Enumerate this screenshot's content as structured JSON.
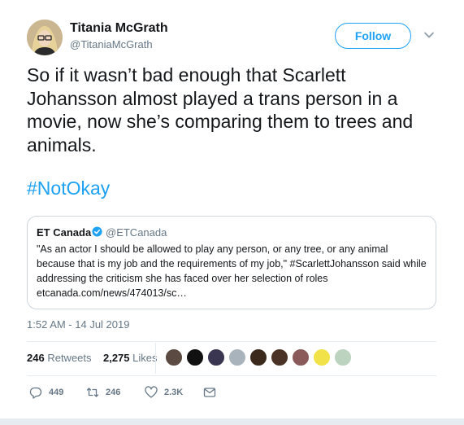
{
  "author": {
    "name": "Titania McGrath",
    "handle": "@TitaniaMcGrath",
    "follow_label": "Follow"
  },
  "tweet": {
    "text": "So if it wasn’t bad enough that Scarlett Johansson almost played a trans person in a movie, now she’s comparing them to trees and animals.",
    "hashtag": "#NotOkay"
  },
  "quoted": {
    "name": "ET Canada",
    "handle": "@ETCanada",
    "text": "\"As an actor I should be allowed to play any person, or any tree, or any animal because that is my job and the requirements of my job,\" #ScarlettJohansson said while addressing the criticism she has faced over her selection of roles etcanada.com/news/474013/sc…"
  },
  "timestamp": "1:52 AM - 14 Jul 2019",
  "stats": {
    "retweets_count": "246",
    "retweets_label": "Retweets",
    "likes_count": "2,275",
    "likes_label": "Likes"
  },
  "liker_avatars": [
    {
      "color": "#5a4a42"
    },
    {
      "color": "#111111"
    },
    {
      "color": "#3a3550"
    },
    {
      "color": "#a9b3bc"
    },
    {
      "color": "#3b2a1c"
    },
    {
      "color": "#4a3326"
    },
    {
      "color": "#8a5a5a"
    },
    {
      "color": "#f2e24a"
    },
    {
      "color": "#bcd3c0"
    }
  ],
  "actions": {
    "reply_count": "449",
    "retweet_count": "246",
    "like_count": "2.3K"
  },
  "colors": {
    "accent": "#1da1f2",
    "muted": "#657786",
    "border": "#ccd6dd"
  }
}
